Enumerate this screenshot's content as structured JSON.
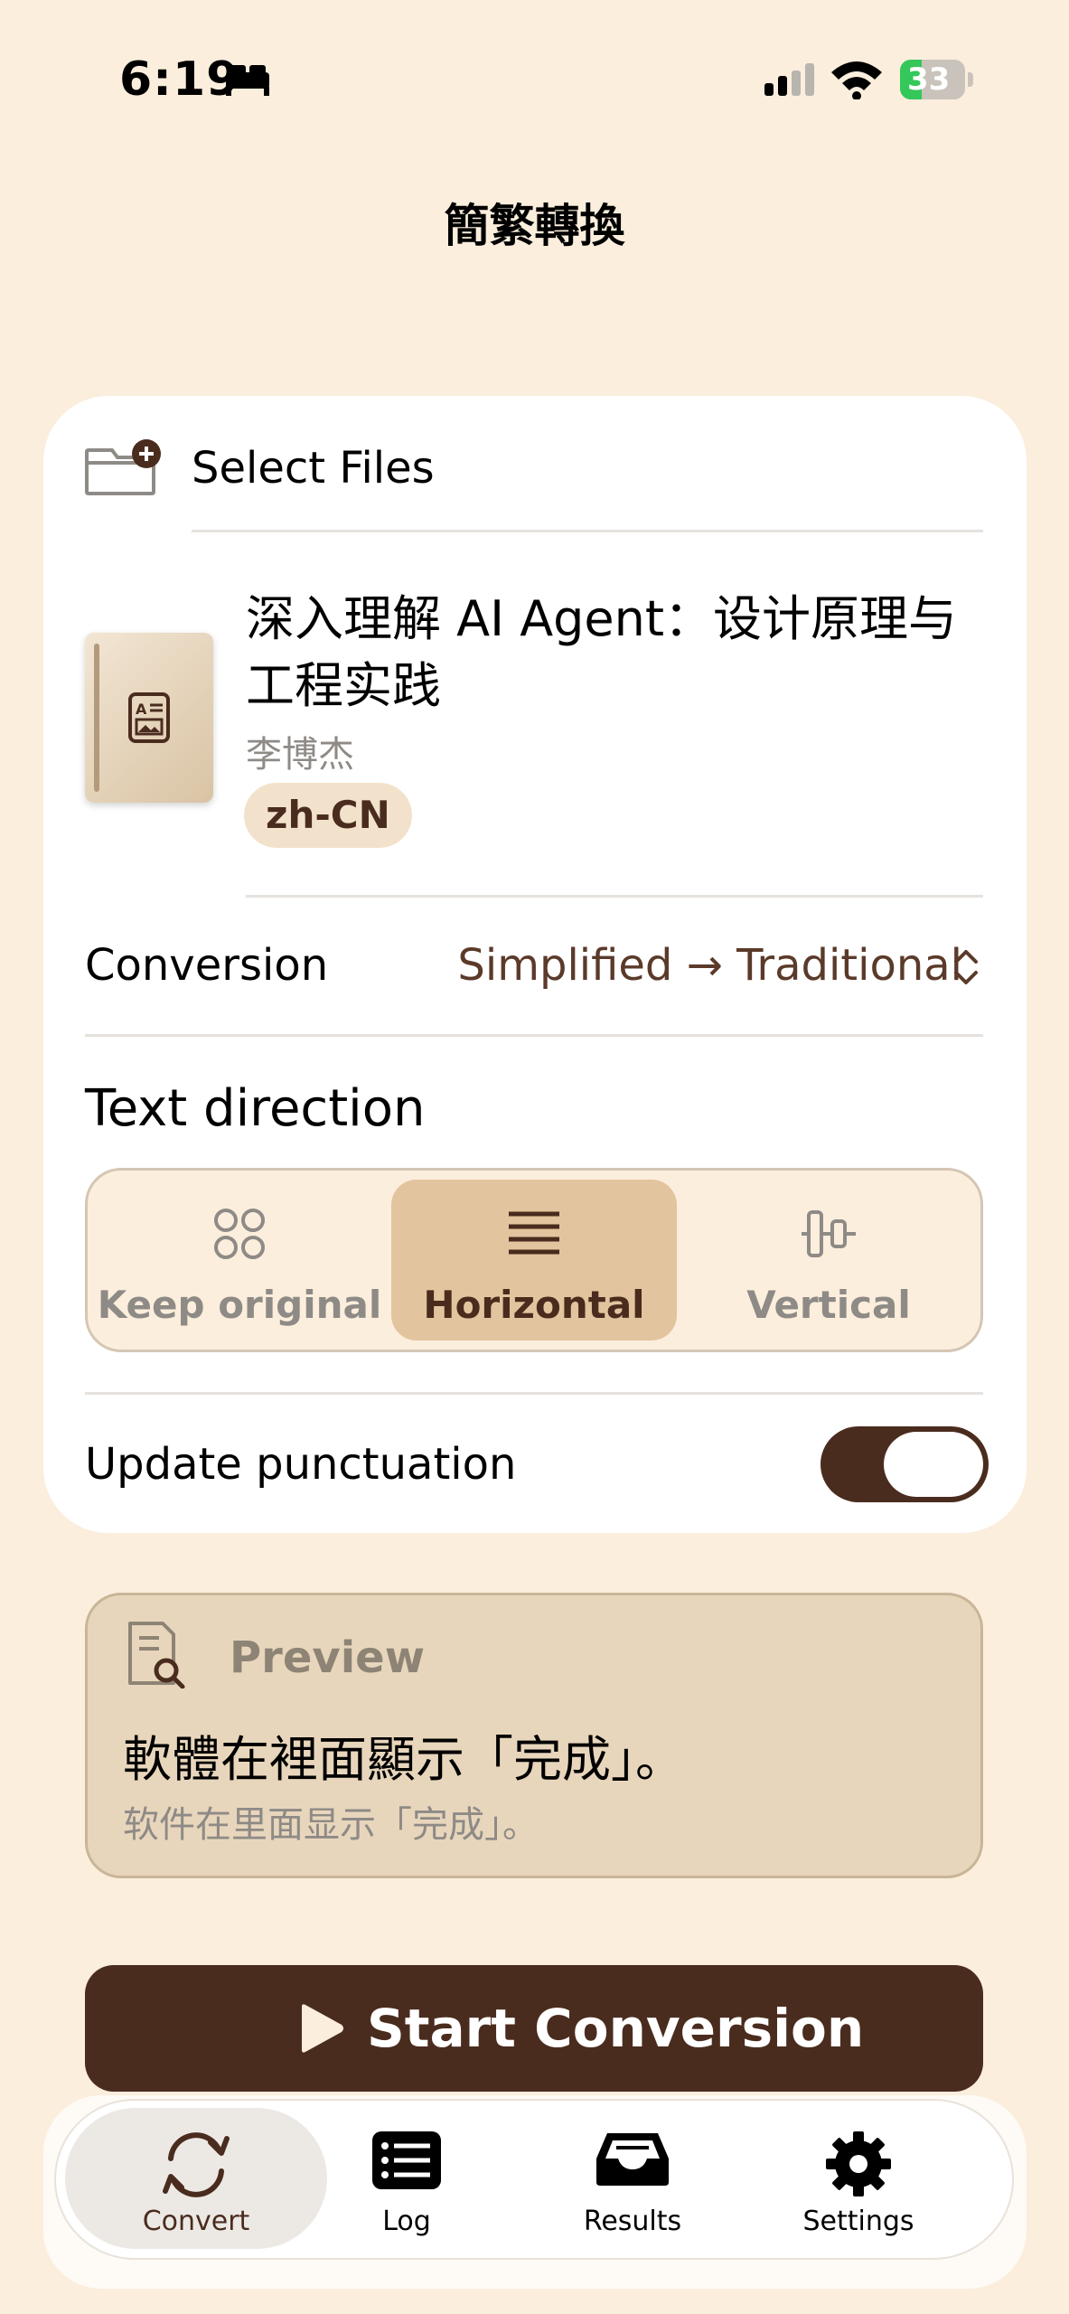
{
  "status_bar": {
    "time": "6:19",
    "battery": "33",
    "battery_level": 0.33
  },
  "app": {
    "title": "簡繁轉換"
  },
  "select_files": {
    "label": "Select Files"
  },
  "book": {
    "title": "深入理解 AI Agent：设计原理与工程实践",
    "author": "李博杰",
    "language": "zh-CN"
  },
  "conversion": {
    "label": "Conversion",
    "value": "Simplified → Traditional"
  },
  "text_direction": {
    "label": "Text direction",
    "options": [
      {
        "label": "Keep original",
        "icon": "four-circles-icon"
      },
      {
        "label": "Horizontal",
        "icon": "horizontal-lines-icon"
      },
      {
        "label": "Vertical",
        "icon": "vertical-columns-icon"
      }
    ],
    "selected": "Horizontal"
  },
  "punctuation": {
    "label": "Update punctuation",
    "enabled": true
  },
  "preview": {
    "label": "Preview",
    "traditional": "軟體在裡面顯示「完成」。",
    "simplified": "软件在里面显示「完成」。"
  },
  "start_button": {
    "label": "Start Conversion"
  },
  "tabs": [
    {
      "label": "Convert",
      "icon": "convert-icon"
    },
    {
      "label": "Log",
      "icon": "log-icon"
    },
    {
      "label": "Results",
      "icon": "tray-icon"
    },
    {
      "label": "Settings",
      "icon": "gear-icon"
    }
  ],
  "active_tab": "Convert",
  "colors": {
    "background": "#FBEEDD",
    "accent": "#4A2C1E",
    "selected_segment": "#E2C49E"
  }
}
